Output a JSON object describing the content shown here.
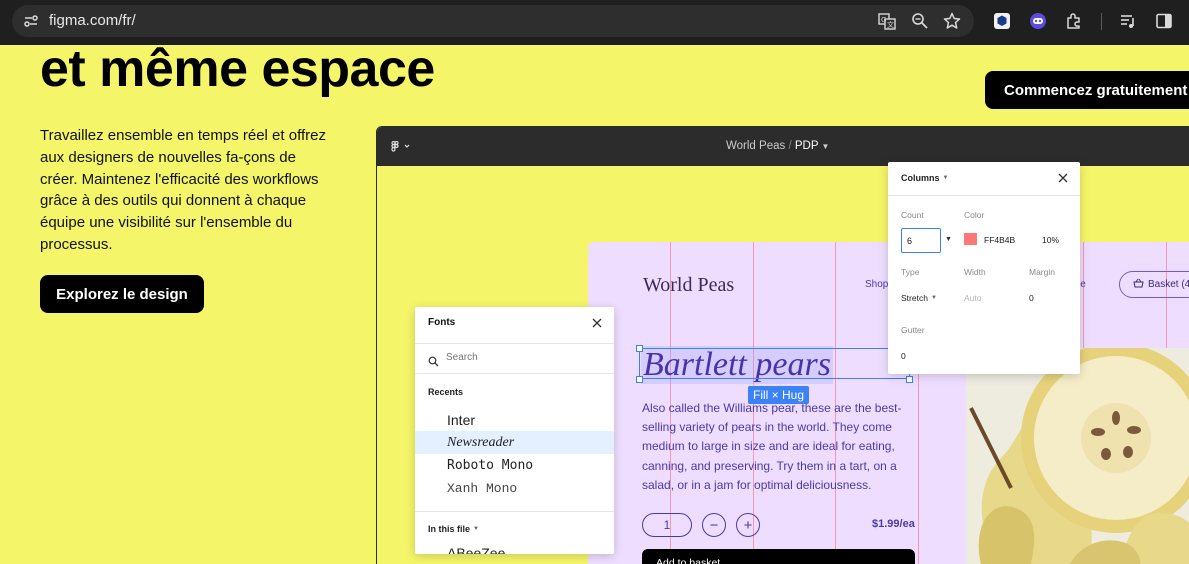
{
  "browser": {
    "url": "figma.com/fr/",
    "icons": [
      "site-info-icon",
      "translate-icon",
      "zoom-icon",
      "bookmark-star-icon",
      "extension-1-icon",
      "extension-2-icon",
      "extensions-puzzle-icon",
      "media-queue-icon",
      "side-panel-icon"
    ]
  },
  "hero": {
    "title": "et même espace",
    "description": "Travaillez ensemble en temps réel et offrez aux designers de nouvelles fa-çons de créer. Maintenez l'efficacité des workflows grâce à des outils qui donnent à chaque équipe une visibilité sur l'ensemble du processus.",
    "explore_button": "Explorez le design",
    "start_button": "Commencez gratuitement"
  },
  "app": {
    "project": "World Peas",
    "separator": "/",
    "page": "PDP",
    "canvas": {
      "brand": "World Peas",
      "nav_shop": "Shop",
      "nav_file": "file",
      "basket": "Basket (4",
      "product_title": "Bartlett pears",
      "size_badge": "Fill × Hug",
      "description": "Also called the Williams pear, these are the best-selling variety of pears in the world. They come medium to large in size and are ideal for eating, canning, and preserving. Try them in a tart, on a salad, or in a jam for optimal deliciousness.",
      "quantity": "1",
      "minus": "−",
      "plus": "+",
      "price": "$1.99/ea",
      "add_button": "Add to basket"
    },
    "fonts_panel": {
      "title": "Fonts",
      "search_placeholder": "Search",
      "recents_label": "Recents",
      "recents": [
        {
          "name": "Inter",
          "selected": false
        },
        {
          "name": "Newsreader",
          "selected": true
        },
        {
          "name": "Roboto Mono",
          "selected": false
        },
        {
          "name": "Xanh Mono",
          "selected": false
        }
      ],
      "in_file_label": "In this file",
      "partial_item": "ABeeZee"
    },
    "columns_panel": {
      "title": "Columns",
      "count_label": "Count",
      "count_value": "6",
      "color_label": "Color",
      "color_hex": "FF4B4B",
      "color_opacity": "10%",
      "type_label": "Type",
      "type_value": "Stretch",
      "width_label": "Width",
      "width_value": "Auto",
      "margin_label": "Margin",
      "margin_value": "0",
      "gutter_label": "Gutter",
      "gutter_value": "0"
    }
  },
  "colors": {
    "background": "#F5F56A",
    "accent": "#3B82F6",
    "column_color": "#FF4B4B",
    "page": "#EEDDFF"
  }
}
